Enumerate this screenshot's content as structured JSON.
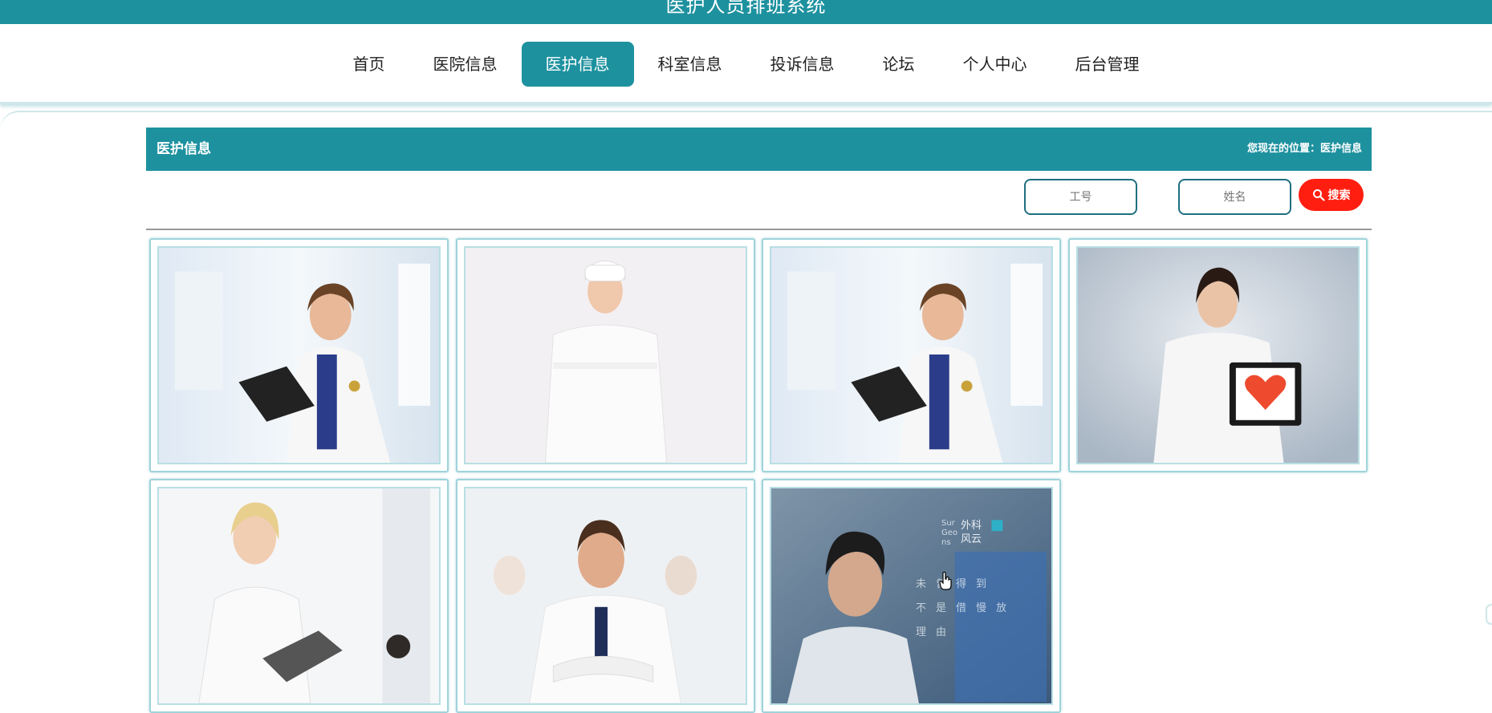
{
  "header": {
    "title": "医护人员排班系统"
  },
  "nav": {
    "items": [
      {
        "label": "首页",
        "active": false
      },
      {
        "label": "医院信息",
        "active": false
      },
      {
        "label": "医护信息",
        "active": true
      },
      {
        "label": "科室信息",
        "active": false
      },
      {
        "label": "投诉信息",
        "active": false
      },
      {
        "label": "论坛",
        "active": false
      },
      {
        "label": "个人中心",
        "active": false
      },
      {
        "label": "后台管理",
        "active": false
      }
    ]
  },
  "section": {
    "title": "医护信息",
    "breadcrumb": "您现在的位置：医护信息"
  },
  "search": {
    "job_no_placeholder": "工号",
    "name_placeholder": "姓名",
    "button_label": "搜索",
    "button_icon": "search-icon"
  },
  "colors": {
    "primary": "#1e919f",
    "search_button": "#ff1e10",
    "card_border": "#9fd3da"
  },
  "cards": [
    {
      "image": "female-doctor-with-tablet"
    },
    {
      "image": "nurse-in-white-uniform"
    },
    {
      "image": "female-doctor-with-tablet"
    },
    {
      "image": "doctor-holding-heart-tablet"
    },
    {
      "image": "blonde-doctor-with-clipboard"
    },
    {
      "image": "smiling-male-doctor"
    },
    {
      "image": "male-doctor-thinking-poster",
      "poster_text": [
        "外科",
        "风云",
        "Sur",
        "Geo",
        "ns",
        "未",
        "曾",
        "得",
        "到",
        "不",
        "是",
        "借",
        "慢",
        "放",
        "理",
        "由"
      ]
    }
  ]
}
